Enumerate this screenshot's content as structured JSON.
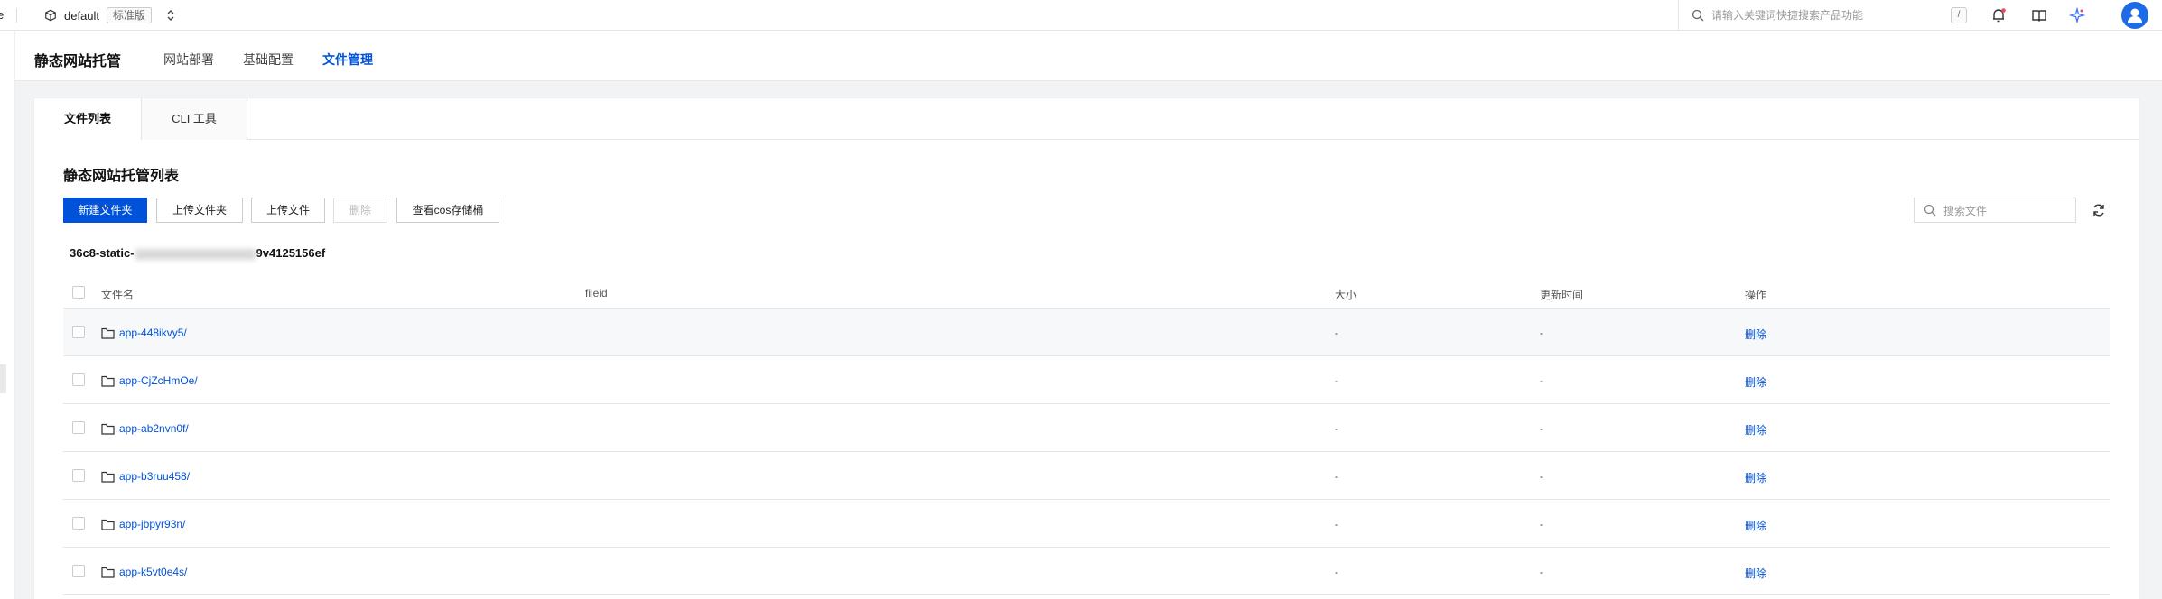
{
  "topbar": {
    "edge_char": "e",
    "project_name": "default",
    "edition_badge": "标准版",
    "search_placeholder": "请输入关键词快捷搜索产品功能",
    "search_shortcut": "/"
  },
  "subheader": {
    "title": "静态网站托管",
    "nav": [
      "网站部署",
      "基础配置",
      "文件管理"
    ],
    "active_nav": "文件管理"
  },
  "tabs": [
    "文件列表",
    "CLI 工具"
  ],
  "section_title": "静态网站托管列表",
  "toolbar": {
    "new_folder": "新建文件夹",
    "upload_folder": "上传文件夹",
    "upload_file": "上传文件",
    "delete": "删除",
    "view_cos": "查看cos存储桶",
    "search_placeholder": "搜索文件"
  },
  "bucket": {
    "prefix": "36c8-static-",
    "suffix": "9v4125156ef"
  },
  "table": {
    "columns": [
      "文件名",
      "fileid",
      "大小",
      "更新时间",
      "操作"
    ],
    "rows": [
      {
        "name": "app-448ikvy5/",
        "fileid": "",
        "size": "-",
        "updated": "-",
        "action": "删除"
      },
      {
        "name": "app-CjZcHmOe/",
        "fileid": "",
        "size": "-",
        "updated": "-",
        "action": "删除"
      },
      {
        "name": "app-ab2nvn0f/",
        "fileid": "",
        "size": "-",
        "updated": "-",
        "action": "删除"
      },
      {
        "name": "app-b3ruu458/",
        "fileid": "",
        "size": "-",
        "updated": "-",
        "action": "删除"
      },
      {
        "name": "app-jbpyr93n/",
        "fileid": "",
        "size": "-",
        "updated": "-",
        "action": "删除"
      },
      {
        "name": "app-k5vt0e4s/",
        "fileid": "",
        "size": "-",
        "updated": "-",
        "action": "删除"
      }
    ]
  },
  "colors": {
    "primary": "#0052d9",
    "avatar": "#1d6be5",
    "notification_dot": "#e34d59"
  }
}
